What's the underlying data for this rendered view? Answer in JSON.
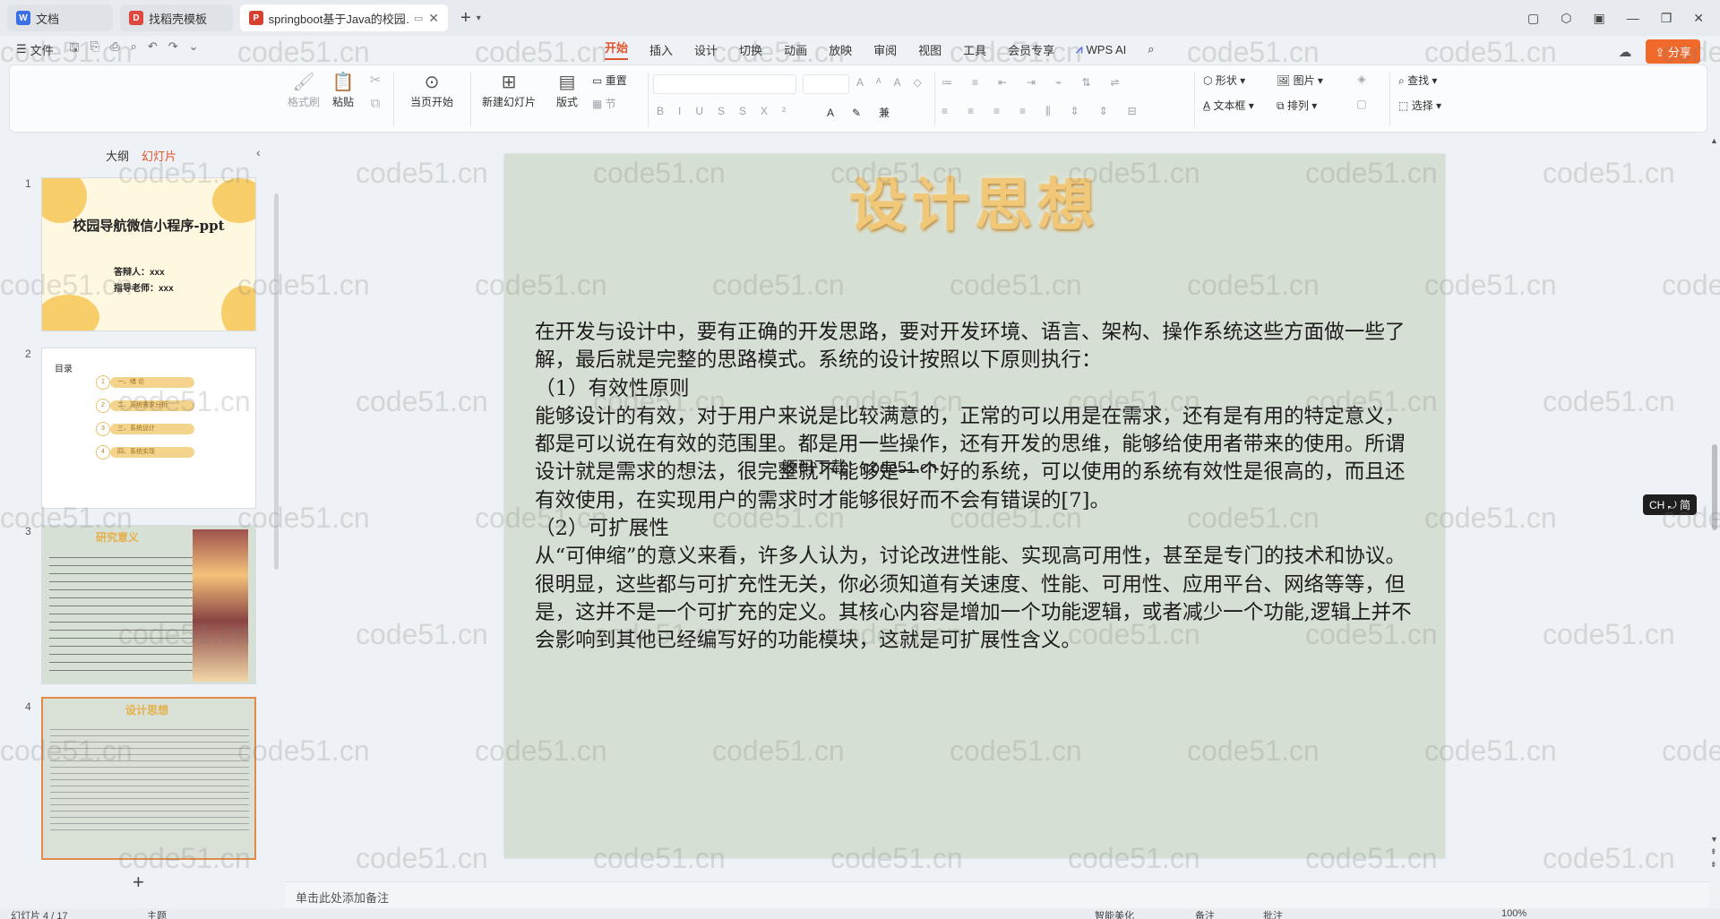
{
  "tabs": [
    {
      "label": "文档",
      "color": "#3a6fe8",
      "icon": "document-icon"
    },
    {
      "label": "找稻壳模板",
      "color": "#e0463c",
      "icon": "template-icon"
    },
    {
      "label": "springboot基于Java的校园…",
      "color": "#d5402f",
      "icon": "ppt-icon"
    }
  ],
  "menu": {
    "file": "文件",
    "items": [
      "开始",
      "插入",
      "设计",
      "切换",
      "动画",
      "放映",
      "审阅",
      "视图",
      "工具",
      "会员专享"
    ],
    "ai": "WPS AI",
    "share": "分享"
  },
  "ribbon": {
    "format_painter": "格式刷",
    "paste": "粘贴",
    "play_from_current": "当页开始",
    "new_slide": "新建幻灯片",
    "layout": "版式",
    "reset": "重置",
    "section": "节",
    "shape": "形状",
    "picture": "图片",
    "textbox": "文本框",
    "arrange": "排列",
    "find": "查找",
    "select": "选择"
  },
  "panel": {
    "tab_outline": "大纲",
    "tab_slides": "幻灯片",
    "thumbs": [
      {
        "num": "1",
        "title": "校园导航微信小程序-ppt",
        "line1": "答辩人：xxx",
        "line2": "指导老师：xxx"
      },
      {
        "num": "2",
        "title": "目录",
        "items": [
          "一、绪 论",
          "二、系统需求分析",
          "三、系统设计",
          "四、系统实现"
        ]
      },
      {
        "num": "3",
        "title": "研究意义"
      },
      {
        "num": "4",
        "title": "设计思想"
      }
    ]
  },
  "slide": {
    "title": "设计思想",
    "paragraphs": [
      "在开发与设计中，要有正确的开发思路，要对开发环境、语言、架构、操作系统这些方面做一些了解，最后就是完整的思路模式。系统的设计按照以下原则执行：",
      "（1）有效性原则",
      "能够设计的有效，对于用户来说是比较满意的，正常的可以用是在需求，还有是有用的特定意义，都是可以说在有效的范围里。都是用一些操作，还有开发的思维，能够给使用者带来的使用。所谓设计就是需求的想法，很完整就不能够是一个好的系统，可以使用的系统有效性是很高的，而且还有效使用，在实现用户的需求时才能够很好而不会有错误的[7]。",
      "（2）可扩展性",
      "从“可伸缩”的意义来看，许多人认为，讨论改进性能、实现高可用性，甚至是专门的技术和协议。很明显，这些都与可扩充性无关，你必须知道有关速度、性能、可用性、应用平台、网络等等，但是，这并不是一个可扩充的定义。其核心内容是增加一个功能逻辑，或者减少一个功能,逻辑上并不会影响到其他已经编写好的功能模块，这就是可扩展性含义。"
    ],
    "overlay": "源码下载：code51.cn"
  },
  "ime_badge": "CH ⤾ 简",
  "notes_placeholder": "单击此处添加备注",
  "status": {
    "slide_count": "幻灯片 4 / 17",
    "theme": "主题",
    "smart": "智能美化",
    "notes": "备注",
    "comments": "批注",
    "zoom": "100%"
  },
  "watermark": "code51.cn"
}
